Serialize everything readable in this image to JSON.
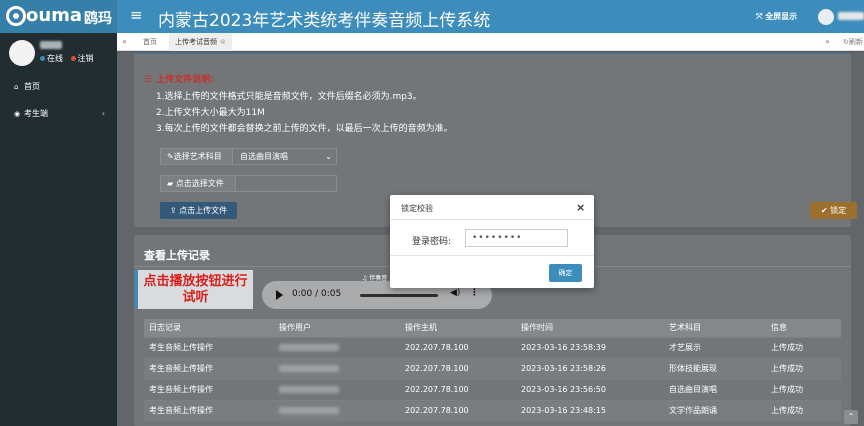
{
  "header": {
    "logo_text": "ouma",
    "logo_cn": "鸥玛",
    "menu_icon": "≡",
    "title": "内蒙古2023年艺术类统考伴奏音频上传系统",
    "fullscreen_label": "全屏显示"
  },
  "sidebar": {
    "status_online": "在线",
    "logout": "注销",
    "items": [
      {
        "icon": "home-icon",
        "label": "首页"
      },
      {
        "icon": "user-icon",
        "label": "考生端"
      }
    ]
  },
  "tabs": {
    "prev": "«",
    "next": "»",
    "refresh": "刷新",
    "items": [
      {
        "label": "首页"
      },
      {
        "label": "上传考试音频",
        "close": "⊗"
      }
    ]
  },
  "upload": {
    "notes_title": "上传文件说明:",
    "notes": [
      "1.选择上传的文件格式只能是音频文件，文件后缀名必须为.mp3。",
      "2.上传文件大小最大为11M",
      "3.每次上传的文件都会替换之前上传的文件，以最后一次上传的音频为准。"
    ],
    "subject_label": "选择艺术科目",
    "subject_value": "自选曲目演唱",
    "file_label": "点击选择文件",
    "upload_button": "点击上传文件",
    "lock_button": "锁定"
  },
  "records": {
    "title": "查看上传记录",
    "hint": "点击播放按钮进行试听",
    "audio_tag": "伴奏音",
    "audio_time": "0:00 / 0:05",
    "columns": [
      "日志记录",
      "操作用户",
      "操作主机",
      "操作时间",
      "艺术科目",
      "信息"
    ],
    "rows": [
      {
        "log": "考生音频上传操作",
        "user": "",
        "host": "202.207.78.100",
        "time": "2023-03-16 23:58:39",
        "subject": "才艺展示",
        "info": "上传成功"
      },
      {
        "log": "考生音频上传操作",
        "user": "",
        "host": "202.207.78.100",
        "time": "2023-03-16 23:58:26",
        "subject": "形体技能展现",
        "info": "上传成功"
      },
      {
        "log": "考生音频上传操作",
        "user": "",
        "host": "202.207.78.100",
        "time": "2023-03-16 23:56:50",
        "subject": "自选曲目演唱",
        "info": "上传成功"
      },
      {
        "log": "考生音频上传操作",
        "user": "",
        "host": "202.207.78.100",
        "time": "2023-03-16 23:48:15",
        "subject": "文学作品朗诵",
        "info": "上传成功"
      }
    ]
  },
  "modal": {
    "title": "锁定校验",
    "close": "×",
    "password_label": "登录密码:",
    "password_value": "••••••••",
    "confirm_button": "确定"
  }
}
